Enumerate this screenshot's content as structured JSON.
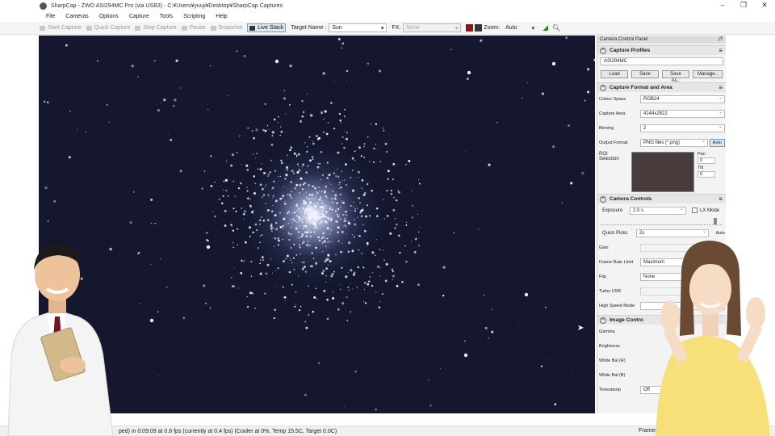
{
  "window": {
    "title": "SharpCap - ZWO ASI294MC Pro (via USB3) - C:¥Users¥yuuji¥Desktop¥SharpCap Captures",
    "buttons": [
      "–",
      "❐",
      "✕"
    ]
  },
  "menu": [
    "File",
    "Cameras",
    "Options",
    "Capture",
    "Tools",
    "Scripting",
    "Help"
  ],
  "toolbar": {
    "start_capture": "Start Capture",
    "quick_capture": "Quick Capture",
    "stop_capture": "Stop Capture",
    "pause": "Pause",
    "snapshot": "Snapshot",
    "live_stack": "Live Stack",
    "target_label": "Target Name :",
    "target_value": "Sun",
    "fx_label": "FX:",
    "fx_value": "None",
    "zoom_label": "Zoom:",
    "zoom_value": "Auto"
  },
  "status": {
    "text": "ped) in 0:09:09 at 0.6 fps  (currently at 0.4 fps) (Cooler at 0%, Temp 15.5C, Target 0.0C)",
    "frames": "Frames"
  },
  "panel": {
    "title": "Camera Control Panel",
    "capture_profiles": {
      "header": "Capture Profiles",
      "profile": "ASI294MC",
      "buttons": [
        "Load",
        "Save",
        "Save As..",
        "Manage.."
      ]
    },
    "capture_format": {
      "header": "Capture Format and Area",
      "rows": [
        {
          "label": "Colour Space",
          "value": "RGB24"
        },
        {
          "label": "Capture Area",
          "value": "4144x2822"
        },
        {
          "label": "Binning",
          "value": "2"
        },
        {
          "label": "Output Format",
          "value": "PNG files (*.png)"
        }
      ],
      "auto": "Auto",
      "roi_label": "ROI\nSelection",
      "pan_label": "Pan",
      "pan_value": "0",
      "tilt_label": "Tilt",
      "tilt_value": "0"
    },
    "camera_controls": {
      "header": "Camera Controls",
      "exposure_label": "Exposure",
      "exposure_value": "2.0 s",
      "lx_mode": "LX Mode",
      "quick_picks_label": "Quick Picks",
      "quick_picks_value": "2s",
      "quick_picks_auto": "Auto",
      "rows": [
        {
          "label": "Gain",
          "value": ""
        },
        {
          "label": "Frame Rate Limit",
          "value": "Maximum"
        },
        {
          "label": "Flip",
          "value": "None"
        },
        {
          "label": "Turbo USB",
          "value": ""
        },
        {
          "label": "High Speed Mode",
          "value": ""
        }
      ]
    },
    "image_controls": {
      "header": "Image Contro",
      "rows": [
        {
          "label": "Gamma",
          "value": ""
        },
        {
          "label": "Brightness",
          "value": ""
        },
        {
          "label": "White Bal (R)",
          "value": ""
        },
        {
          "label": "White Bal (B)",
          "value": ""
        },
        {
          "label": "Timestamp",
          "value": "Off"
        }
      ]
    }
  }
}
